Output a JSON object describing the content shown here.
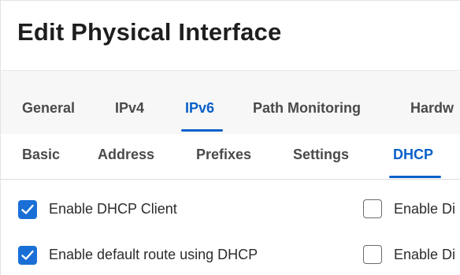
{
  "dialog": {
    "title": "Edit Physical Interface"
  },
  "tabs": [
    {
      "label": "General",
      "active": false
    },
    {
      "label": "IPv4",
      "active": false
    },
    {
      "label": "IPv6",
      "active": true
    },
    {
      "label": "Path Monitoring",
      "active": false
    },
    {
      "label": "Hardw",
      "active": false
    }
  ],
  "subtabs": [
    {
      "label": "Basic",
      "active": false
    },
    {
      "label": "Address",
      "active": false
    },
    {
      "label": "Prefixes",
      "active": false
    },
    {
      "label": "Settings",
      "active": false
    },
    {
      "label": "DHCP",
      "active": true
    }
  ],
  "options": {
    "left": [
      {
        "label": "Enable DHCP Client",
        "checked": true
      },
      {
        "label": "Enable default route using DHCP",
        "checked": true
      }
    ],
    "right": [
      {
        "label": "Enable Di",
        "checked": false
      },
      {
        "label": "Enable Di",
        "checked": false
      }
    ]
  },
  "colors": {
    "accent": "#0a60c9",
    "checkbox_fill": "#1a6fd6",
    "tab_bar_bg": "#f7f7f7"
  }
}
